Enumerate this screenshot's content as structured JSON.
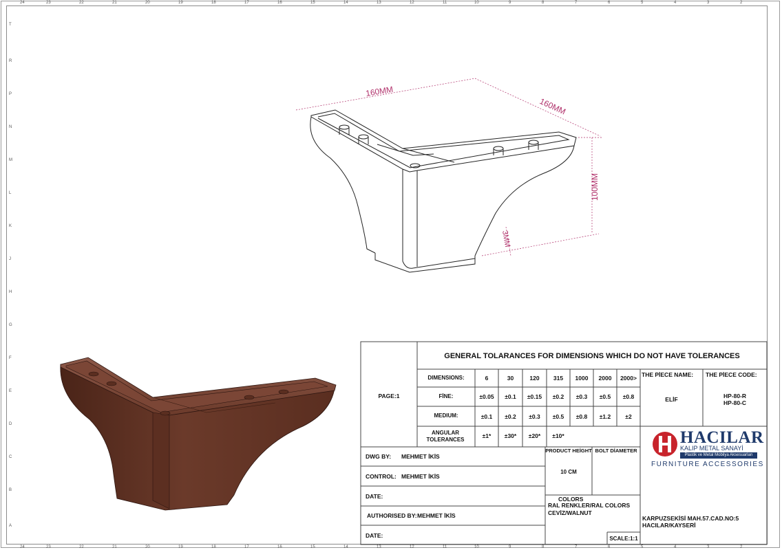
{
  "frame": {
    "columns_top": [
      "24",
      "23",
      "22",
      "21",
      "20",
      "19",
      "18",
      "17",
      "16",
      "15",
      "14",
      "13",
      "12",
      "11",
      "10",
      "9",
      "8",
      "7",
      "6",
      "5",
      "4",
      "3",
      "2"
    ],
    "columns_bottom": [
      "24",
      "23",
      "22",
      "21",
      "20",
      "19",
      "18",
      "17",
      "16",
      "15",
      "14",
      "13",
      "12",
      "11",
      "10",
      "9",
      "8",
      "7",
      "6",
      "5",
      "4",
      "3",
      "2"
    ],
    "rows": [
      "T",
      "R",
      "P",
      "N",
      "M",
      "L",
      "K",
      "J",
      "H",
      "G",
      "F",
      "E",
      "D",
      "C",
      "B",
      "A"
    ]
  },
  "dimensions": {
    "width1": "160MM",
    "width2": "160MM",
    "height": "100MM",
    "thickness": "3MM"
  },
  "colors": {
    "dimension": "#b0306a",
    "product_brown": "#6b3a2a",
    "logo_red": "#c8242c",
    "logo_navy": "#1f3a6b"
  },
  "title_block": {
    "page": "PAGE:1",
    "tolerance_title": "GENERAL TOLARANCES FOR DIMENSIONS WHICH DO NOT HAVE TOLERANCES",
    "tol_rows": [
      {
        "label": "DIMENSIONS:",
        "values": [
          "6",
          "30",
          "120",
          "315",
          "1000",
          "2000",
          "2000>"
        ]
      },
      {
        "label": "FİNE:",
        "values": [
          "±0.05",
          "±0.1",
          "±0.15",
          "±0.2",
          "±0.3",
          "±0.5",
          "±0.8"
        ]
      },
      {
        "label": "MEDIUM:",
        "values": [
          "±0.1",
          "±0.2",
          "±0.3",
          "±0.5",
          "±0.8",
          "±1.2",
          "±2"
        ]
      },
      {
        "label": "ANGULAR TOLERANCES",
        "values": [
          "±1*",
          "±30*",
          "±20*",
          "±10*",
          "",
          "",
          ""
        ]
      }
    ],
    "piece_name_label": "THE PİECE NAME:",
    "piece_name": "ELİF",
    "piece_code_label": "THE PİECE CODE:",
    "piece_code_1": "HP-80-R",
    "piece_code_2": "HP-80-C",
    "dwg_by_label": "DWG BY:",
    "dwg_by": "MEHMET İKİS",
    "control_label": "CONTROL:",
    "control": "MEHMET İKİS",
    "date_label_1": "DATE:",
    "authorised_label": "AUTHORISED BY:",
    "authorised": "MEHMET İKİS",
    "date_label_2": "DATE:",
    "product_height_label": "PRODUCT HEİGHT",
    "product_height": "10 CM",
    "bolt_diameter_label": "BOLT DİAMETER",
    "colors_label": "COLORS",
    "colors_line1": "RAL RENKLER/RAL COLORS",
    "colors_line2": "CEVİZ/WALNUT",
    "scale": "SCALE:1:1",
    "address_1": "KARPUZSEKİSİ MAH.57.CAD.NO:5",
    "address_2": "HACILAR/KAYSERİ"
  },
  "logo": {
    "brand": "HACILAR",
    "line1": "KALIP METAL SANAYİ",
    "line2": "Plastik ve Metal Mobilya Aksesuarları",
    "tagline": "FURNITURE ACCESSORIES"
  }
}
